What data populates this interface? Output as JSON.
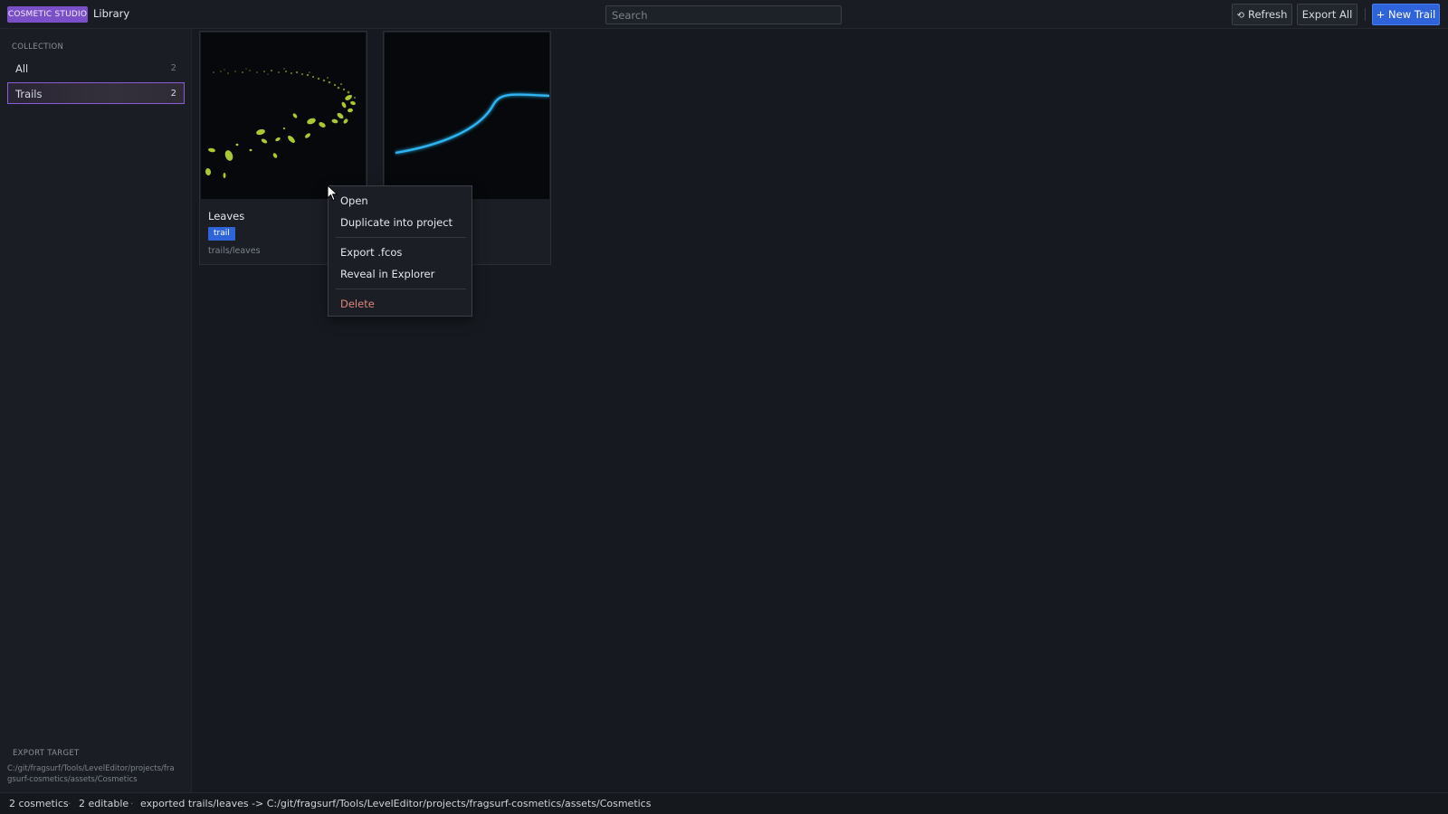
{
  "topbar": {
    "brand": "COSMETIC STUDIO",
    "breadcrumb": "Library",
    "search_placeholder": "Search",
    "search_value": "",
    "refresh_label": "Refresh",
    "export_all_label": "Export All",
    "new_trail_label": "+ New Trail"
  },
  "sidebar": {
    "section_label": "COLLECTION",
    "items": [
      {
        "label": "All",
        "count": "2"
      },
      {
        "label": "Trails",
        "count": "2",
        "selected": true
      }
    ],
    "export_target_label": "EXPORT TARGET",
    "export_target_path": "C:/git/fragsurf/Tools/LevelEditor/projects/fragsurf-cosmetics/assets/Cosmetics"
  },
  "cards": [
    {
      "title": "Leaves",
      "tag": "trail",
      "path": "trails/leaves",
      "thumb": "leaves-preview"
    },
    {
      "title": "",
      "tag": "",
      "path": "",
      "thumb": "blue-trail-preview"
    }
  ],
  "context_menu": {
    "open": "Open",
    "duplicate": "Duplicate into project",
    "export": "Export .fcos",
    "reveal": "Reveal in Explorer",
    "delete": "Delete"
  },
  "statusbar": {
    "count": "2 cosmetics",
    "separator": "·",
    "editable": "2 editable",
    "message": "exported trails/leaves -> C:/git/fragsurf/Tools/LevelEditor/projects/fragsurf-cosmetics/assets/Cosmetics"
  },
  "colors": {
    "brand": "#7b4fc7",
    "accent": "#2f63d9",
    "danger": "#e0857d",
    "leaf": "#a9c832",
    "trail": "#1e9fd8"
  }
}
